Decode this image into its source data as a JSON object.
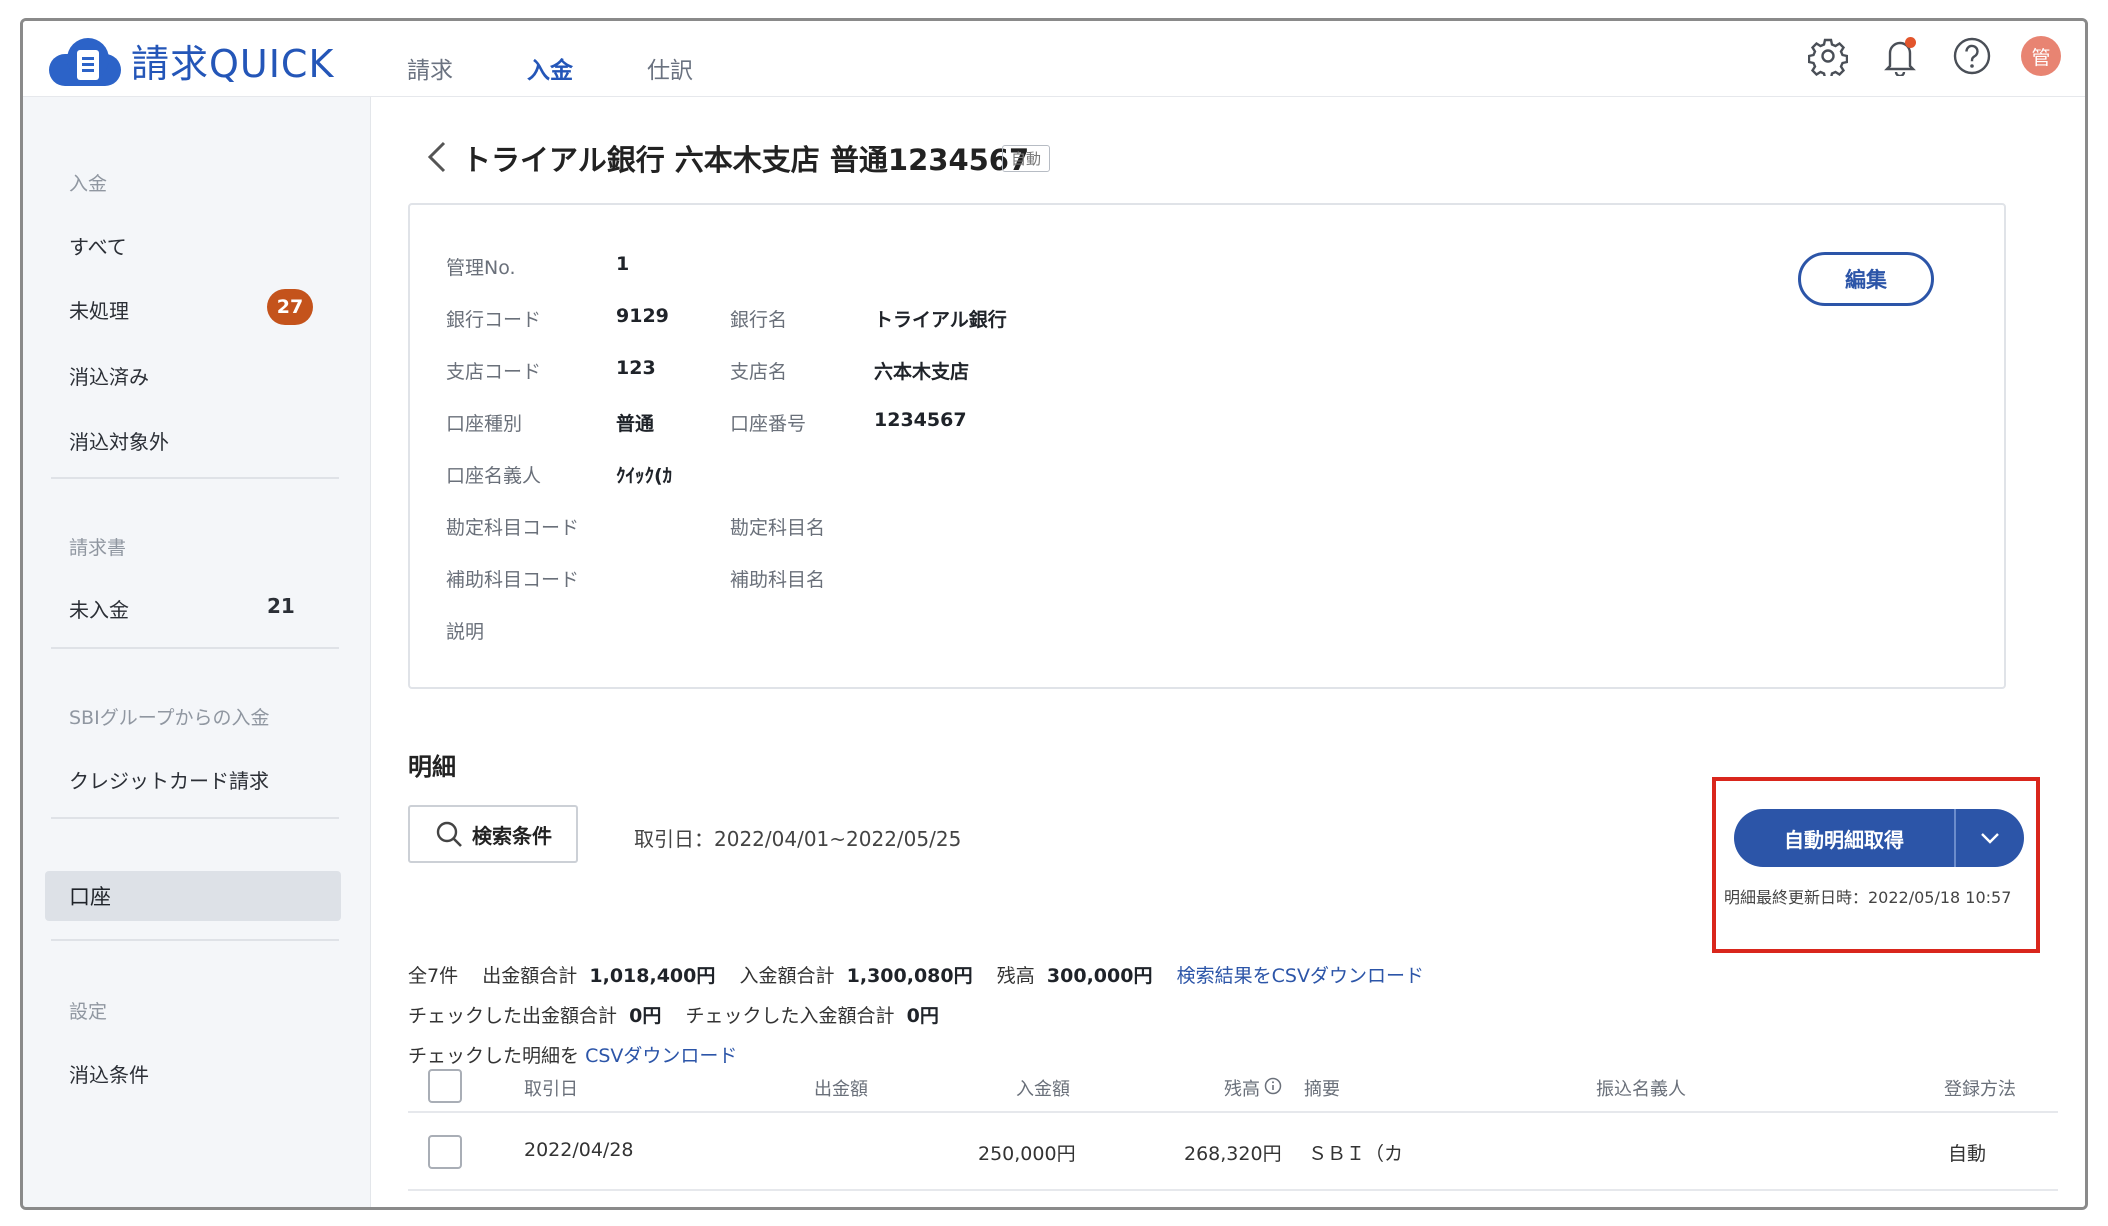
{
  "app": {
    "logo_text": "請求QUICK"
  },
  "topnav": [
    {
      "label": "請求",
      "active": false
    },
    {
      "label": "入金",
      "active": true
    },
    {
      "label": "仕訳",
      "active": false
    }
  ],
  "header": {
    "avatar_text": "管"
  },
  "sidebar": {
    "group_payment": "入金",
    "item_all": "すべて",
    "item_unprocessed": "未処理",
    "badge_unprocessed": "27",
    "item_cleared": "消込済み",
    "item_excluded": "消込対象外",
    "group_invoice": "請求書",
    "item_unpaid": "未入金",
    "count_unpaid": "21",
    "group_sbi": "SBIグループからの入金",
    "item_credit": "クレジットカード請求",
    "item_account": "口座",
    "group_settings": "設定",
    "item_rules": "消込条件"
  },
  "page": {
    "title": "トライアル銀行 六本木支店 普通1234567",
    "tag": "自動"
  },
  "account": {
    "mgmt_no_label": "管理No.",
    "mgmt_no": "1",
    "bank_code_label": "銀行コード",
    "bank_code": "9129",
    "bank_name_label": "銀行名",
    "bank_name": "トライアル銀行",
    "branch_code_label": "支店コード",
    "branch_code": "123",
    "branch_name_label": "支店名",
    "branch_name": "六本木支店",
    "type_label": "口座種別",
    "type": "普通",
    "number_label": "口座番号",
    "number": "1234567",
    "holder_label": "口座名義人",
    "holder": "ｸｲｯｸ(ｶ",
    "subject_code_label": "勘定科目コード",
    "subject_name_label": "勘定科目名",
    "sub_code_label": "補助科目コード",
    "sub_name_label": "補助科目名",
    "desc_label": "説明",
    "edit_label": "編集"
  },
  "details": {
    "section_title": "明細",
    "search_label": "検索条件",
    "date_range": "取引日：2022/04/01~2022/05/25",
    "fetch_label": "自動明細取得",
    "last_update": "明細最終更新日時：2022/05/18 10:57",
    "total_count": "全7件",
    "out_total_label": "出金額合計",
    "out_total": "1,018,400円",
    "in_total_label": "入金額合計",
    "in_total": "1,300,080円",
    "balance_label": "残高",
    "balance": "300,000円",
    "csv_search_link": "検索結果をCSVダウンロード",
    "checked_out_label": "チェックした出金額合計",
    "checked_out": "0円",
    "checked_in_label": "チェックした入金額合計",
    "checked_in": "0円",
    "checked_csv_prefix": "チェックした明細を",
    "checked_csv_link": "CSVダウンロード"
  },
  "table": {
    "headers": {
      "date": "取引日",
      "out": "出金額",
      "in": "入金額",
      "balance": "残高",
      "summary": "摘要",
      "payer": "振込名義人",
      "method": "登録方法"
    },
    "rows": [
      {
        "date": "2022/04/28",
        "out": "",
        "in": "250,000円",
        "balance": "268,320円",
        "summary": "ＳＢＩ（カ",
        "payer": "",
        "method": "自動"
      }
    ]
  },
  "colors": {
    "brand": "#2c55a8",
    "badge": "#c4531c",
    "highlight": "#d9261c"
  }
}
